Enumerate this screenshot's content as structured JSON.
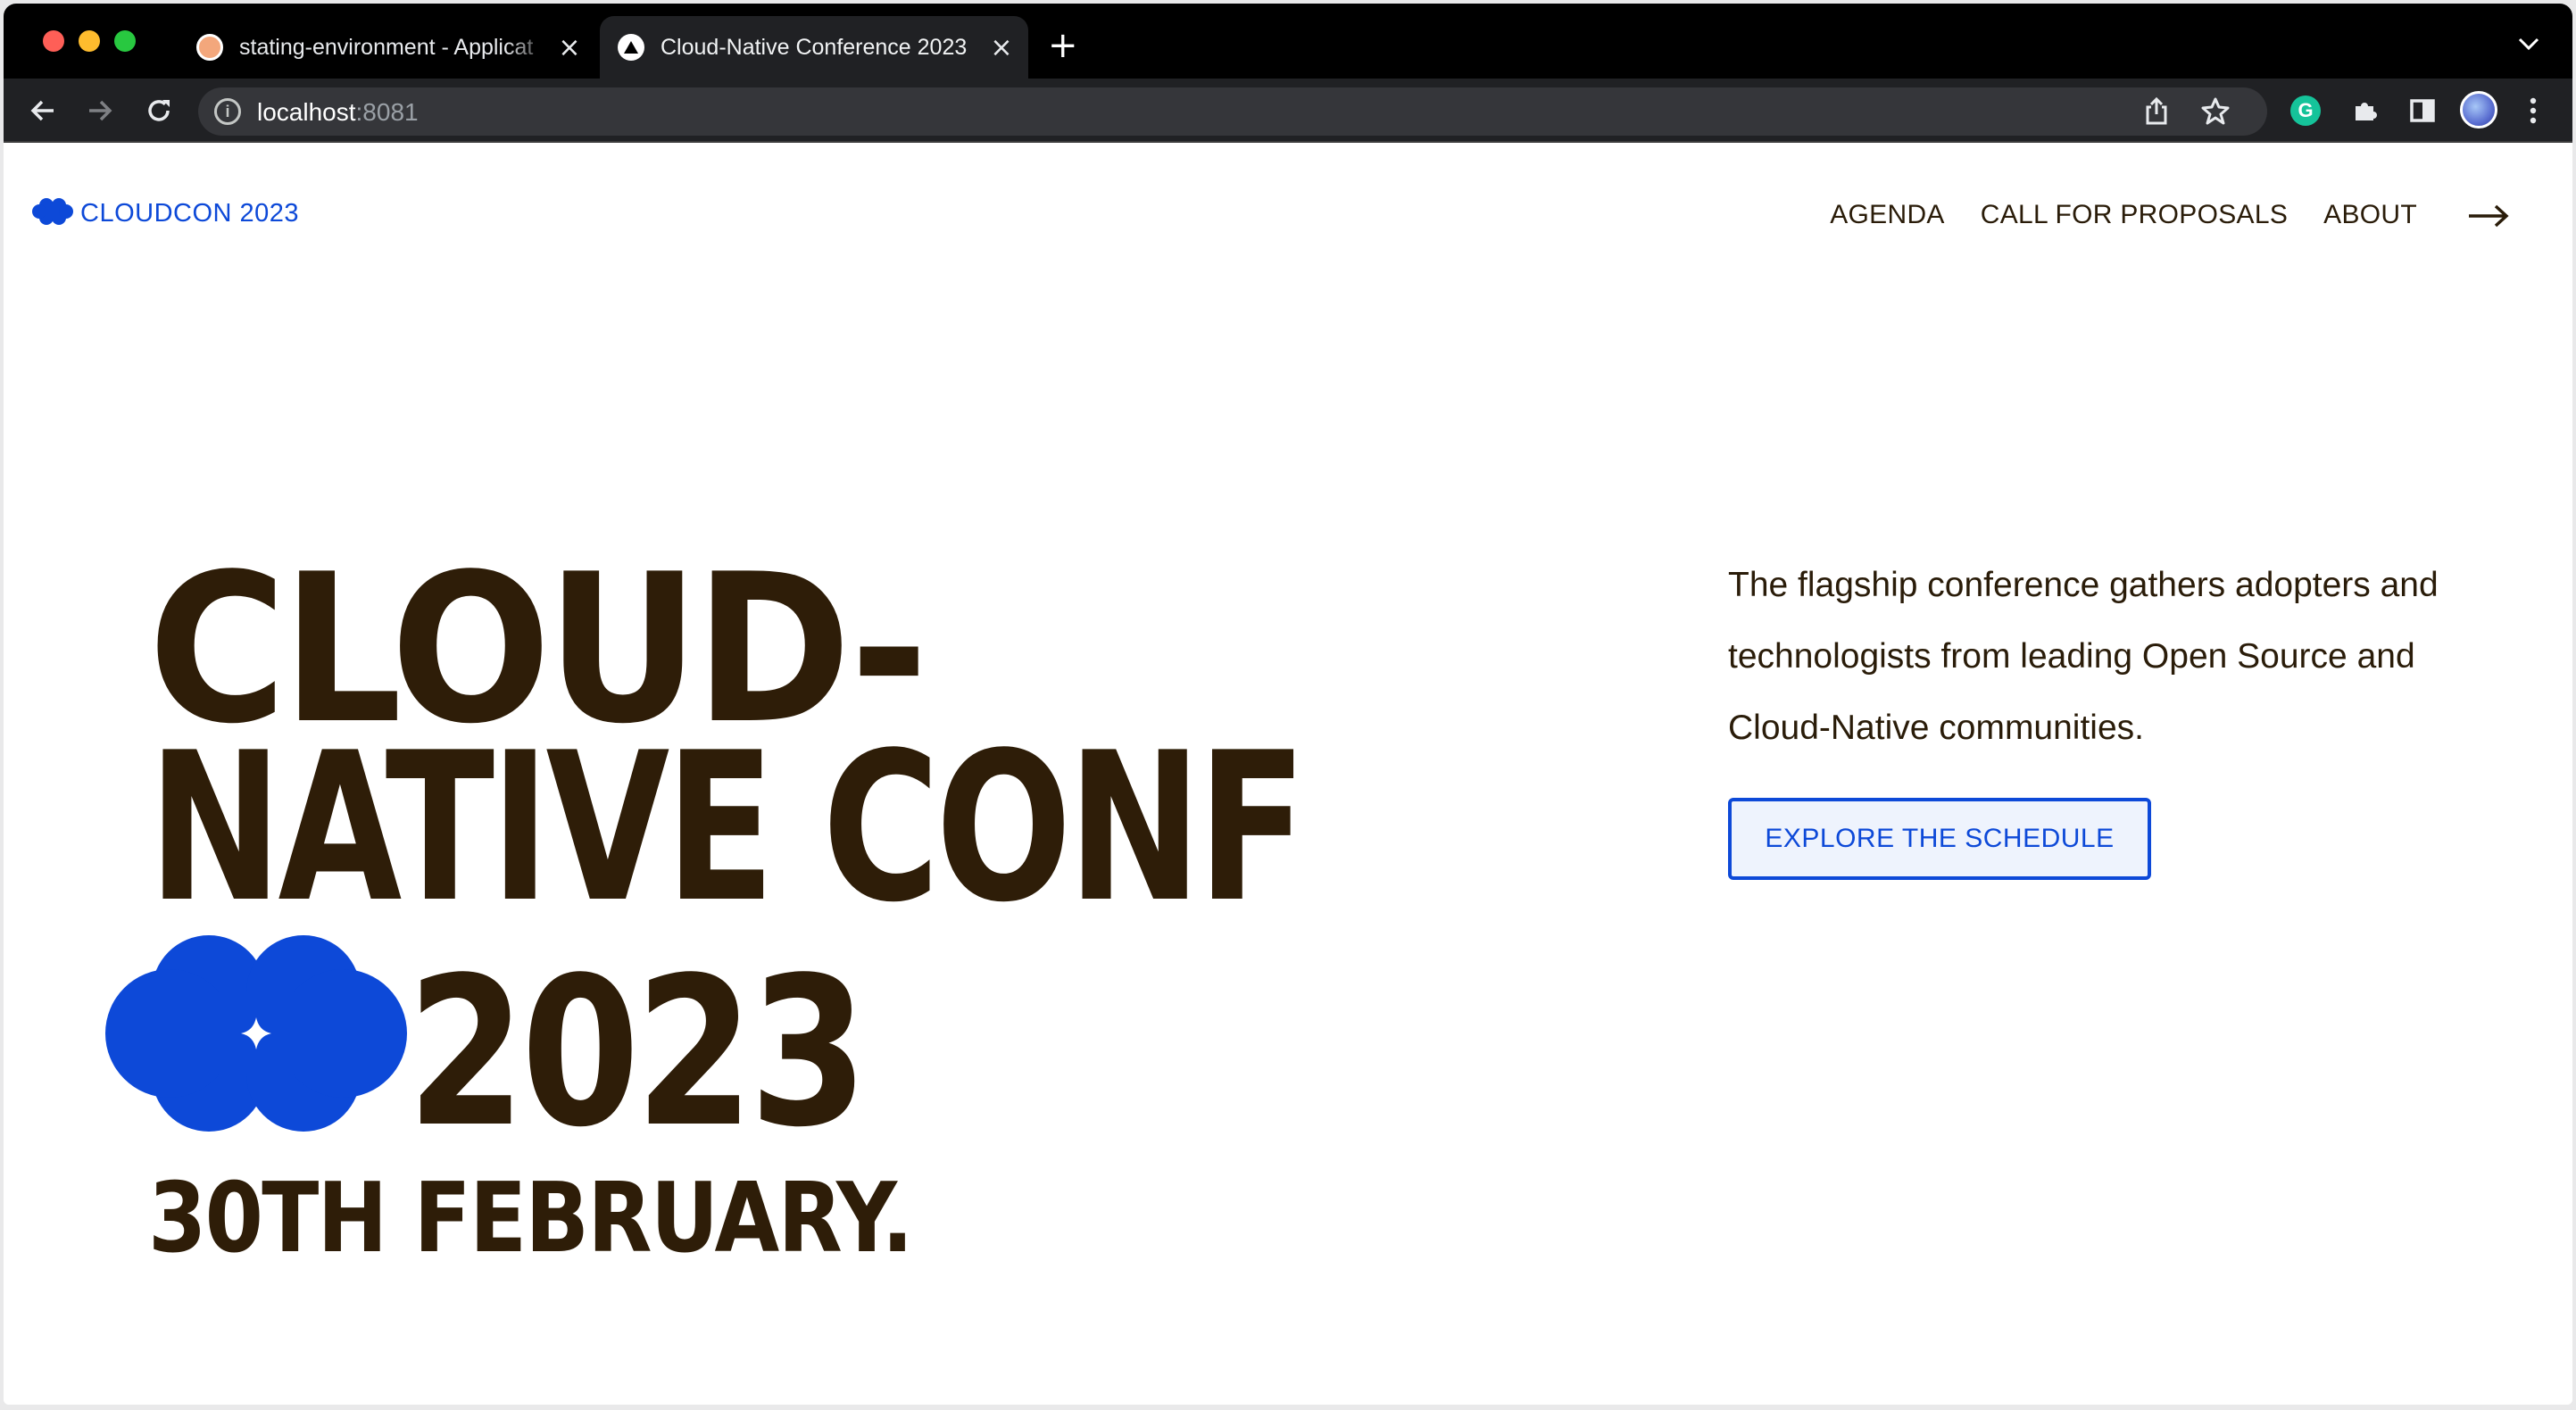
{
  "browser": {
    "tabs": [
      {
        "title": "stating-environment - Applicat",
        "active": false,
        "favicon": "app-favicon"
      },
      {
        "title": "Cloud-Native Conference 2023",
        "active": true,
        "favicon": "triangle-favicon"
      }
    ],
    "new_tab_icon": "+",
    "url_host": "localhost",
    "url_port": ":8081"
  },
  "site": {
    "logo_text": "CLOUDCON 2023",
    "nav": [
      {
        "label": "AGENDA"
      },
      {
        "label": "CALL FOR PROPOSALS"
      },
      {
        "label": "ABOUT"
      }
    ],
    "nav_arrow": "→"
  },
  "hero": {
    "line1": "CLOUD-",
    "line2": "NATIVE CONF",
    "line3": "2023",
    "date": "30TH FEBRUARY.",
    "description": "The flagship conference gathers adopters and technologists from leading Open Source and Cloud-Native communities.",
    "cta_label": "EXPLORE THE SCHEDULE"
  },
  "colors": {
    "brand_blue": "#0d49d8",
    "headline_brown": "#2e1d08",
    "cta_background": "#eef3fd"
  }
}
